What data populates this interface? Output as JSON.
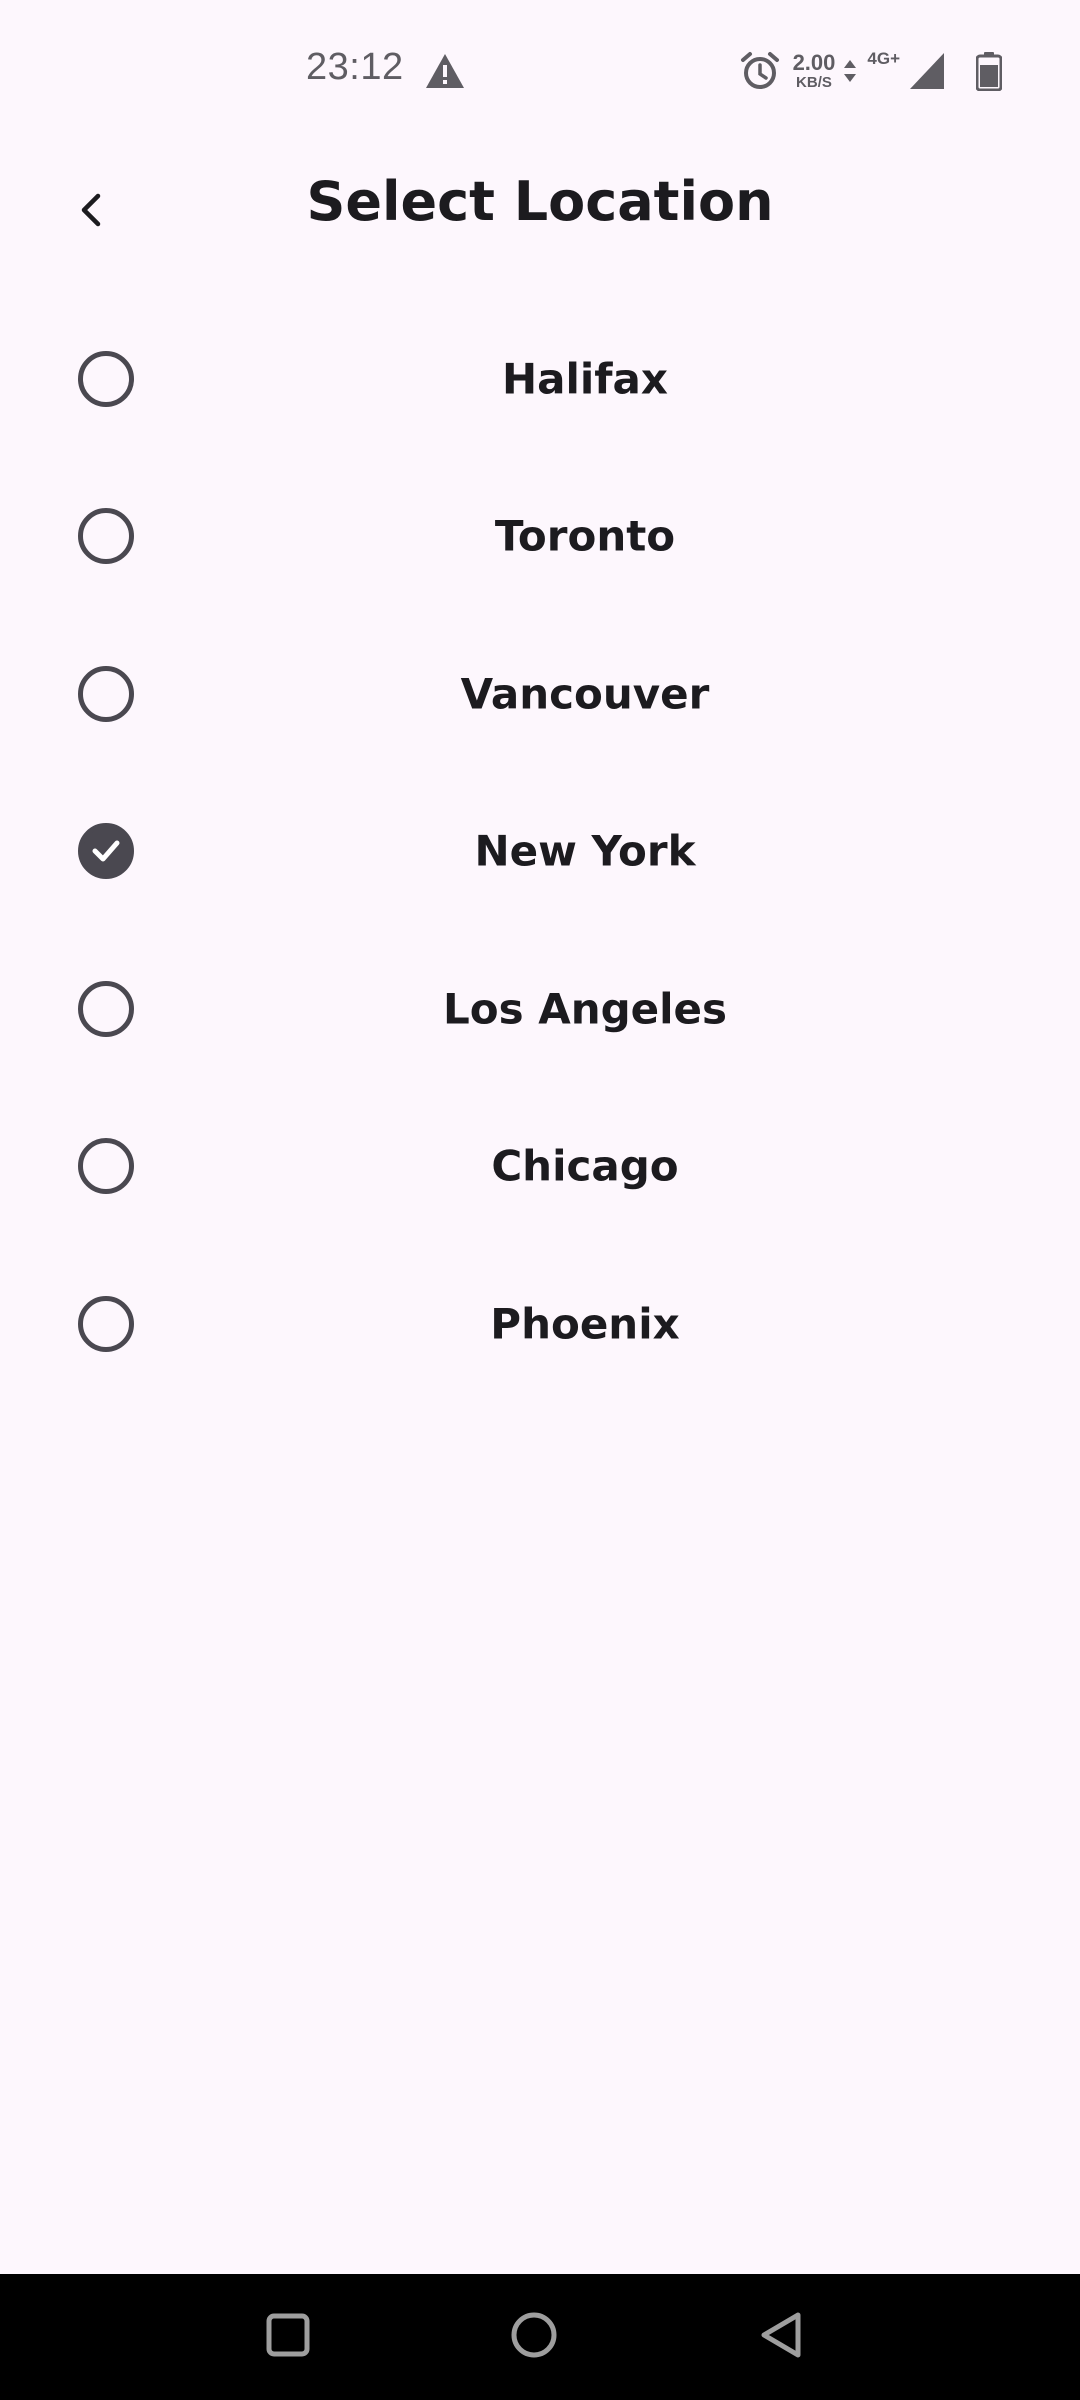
{
  "status_bar": {
    "time": "23:12",
    "net_speed_value": "2.00",
    "net_speed_unit": "KB/S",
    "network_type": "4G+",
    "icons": [
      "warning-icon",
      "alarm-icon",
      "data-arrows-icon",
      "signal-icon",
      "battery-icon"
    ]
  },
  "header": {
    "title": "Select Location",
    "back_icon": "chevron-left-icon"
  },
  "locations": [
    {
      "label": "Halifax",
      "selected": false
    },
    {
      "label": "Toronto",
      "selected": false
    },
    {
      "label": "Vancouver",
      "selected": false
    },
    {
      "label": "New York",
      "selected": true
    },
    {
      "label": "Los Angeles",
      "selected": false
    },
    {
      "label": "Chicago",
      "selected": false
    },
    {
      "label": "Phoenix",
      "selected": false
    }
  ],
  "nav_bar": {
    "icons": [
      "recents-square-icon",
      "home-circle-icon",
      "back-triangle-icon"
    ]
  },
  "colors": {
    "background": "#fdf7fd",
    "text": "#1c1b1f",
    "radio": "#4a4850",
    "status_icon": "#5f5d63",
    "nav_bar": "#000000"
  }
}
